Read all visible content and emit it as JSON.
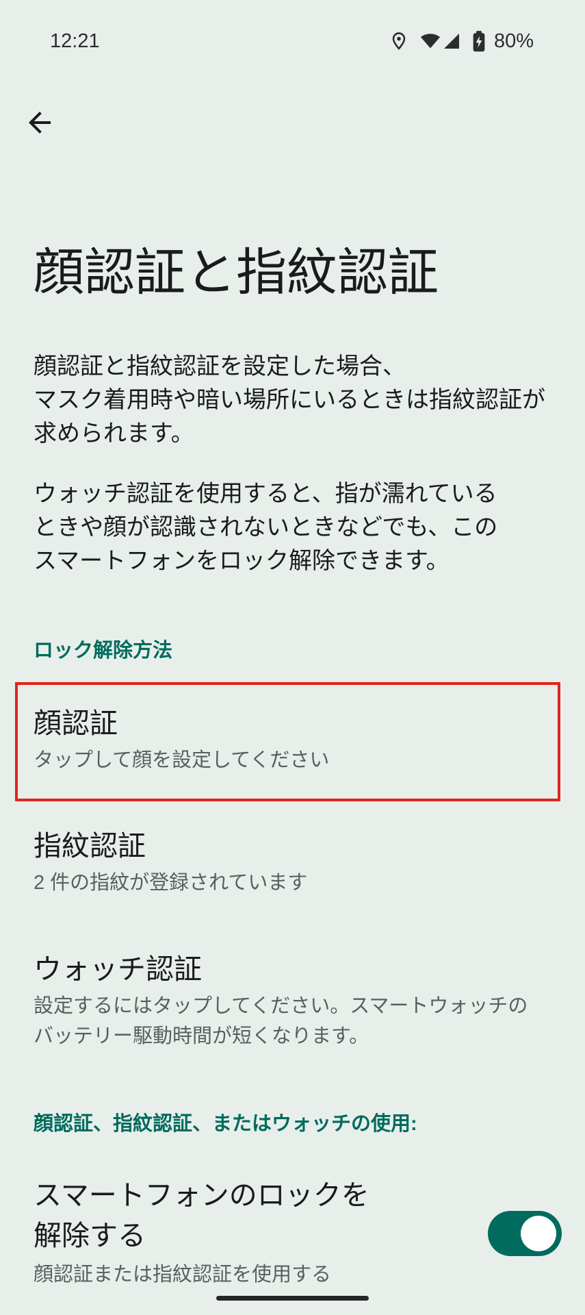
{
  "theme": {
    "background": "#e8efeb",
    "text_primary": "#191c1b",
    "text_secondary": "#58605d",
    "accent": "#006b5e",
    "highlight": "#e2231a"
  },
  "status_bar": {
    "time": "12:21",
    "battery_percent": "80%",
    "icons": {
      "location": "location-icon",
      "wifi": "wifi-icon",
      "signal": "cell-signal-icon",
      "battery": "battery-charging-icon"
    }
  },
  "toolbar": {
    "back_icon": "arrow-back-icon"
  },
  "page": {
    "title": "顔認証と指紋認証",
    "intro": [
      [
        "顔認証と指紋認証を設定した場合、",
        "マスク着用時や暗い場所にいるときは指紋認証が",
        "求められます。"
      ],
      [
        "ウォッチ認証を使用すると、指が濡れている",
        "ときや顔が認識されないときなどでも、この",
        "スマートフォンをロック解除できます。"
      ]
    ]
  },
  "unlock_methods": {
    "header": "ロック解除方法",
    "items": [
      {
        "title": "顔認証",
        "summary": [
          "タップして顔を設定してください"
        ]
      },
      {
        "title": "指紋認証",
        "summary": [
          "2 件の指紋が登録されています"
        ]
      },
      {
        "title": "ウォッチ認証",
        "summary": [
          "設定するにはタップしてください。スマートウォッチの",
          "バッテリー駆動時間が短くなります。"
        ]
      }
    ]
  },
  "usage": {
    "header": "顔認証、指紋認証、またはウォッチの使用:",
    "items": [
      {
        "title": [
          "スマートフォンのロックを",
          "解除する"
        ],
        "summary": "顔認証または指紋認証を使用する",
        "toggle_on": true
      }
    ]
  }
}
